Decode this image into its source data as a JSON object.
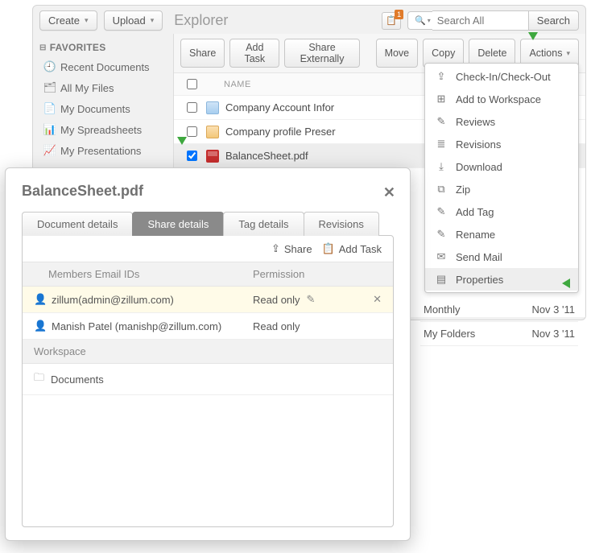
{
  "header": {
    "create_label": "Create",
    "upload_label": "Upload",
    "title": "Explorer",
    "notif_count": "1",
    "search_placeholder": "Search All",
    "search_button": "Search"
  },
  "sidebar": {
    "favorites_label": "FAVORITES",
    "items": [
      {
        "icon": "clock",
        "label": "Recent Documents"
      },
      {
        "icon": "files",
        "label": "All My Files"
      },
      {
        "icon": "doc",
        "label": "My Documents"
      },
      {
        "icon": "sheet",
        "label": "My Spreadsheets"
      },
      {
        "icon": "pres",
        "label": "My Presentations"
      }
    ]
  },
  "toolbar": {
    "share": "Share",
    "add_task": "Add Task",
    "share_ext": "Share Externally",
    "move": "Move",
    "copy": "Copy",
    "delete": "Delete",
    "actions": "Actions"
  },
  "table": {
    "header_name": "NAME",
    "rows": [
      {
        "checked": false,
        "type": "doc",
        "name": "Company Account Infor"
      },
      {
        "checked": false,
        "type": "ppt",
        "name": "Company profile Preser"
      },
      {
        "checked": true,
        "type": "pdf",
        "name": "BalanceSheet.pdf"
      }
    ]
  },
  "actions_menu": [
    {
      "icon": "⇪",
      "label": "Check-In/Check-Out"
    },
    {
      "icon": "⊞",
      "label": "Add to Workspace"
    },
    {
      "icon": "✎",
      "label": "Reviews"
    },
    {
      "icon": "≣",
      "label": "Revisions"
    },
    {
      "icon": "⤓",
      "label": "Download"
    },
    {
      "icon": "⧉",
      "label": "Zip"
    },
    {
      "icon": "✎",
      "label": "Add Tag"
    },
    {
      "icon": "✎",
      "label": "Rename"
    },
    {
      "icon": "✉",
      "label": "Send Mail"
    },
    {
      "icon": "▤",
      "label": "Properties",
      "highlight": true
    }
  ],
  "extra_rows": [
    {
      "label": "Monthly",
      "date": "Nov 3 '11"
    },
    {
      "label": "My Folders",
      "date": "Nov 3 '11"
    }
  ],
  "popup": {
    "title": "BalanceSheet.pdf",
    "tabs": {
      "doc_details": "Document details",
      "share_details": "Share details",
      "tag_details": "Tag details",
      "revisions": "Revisions"
    },
    "actions": {
      "share": "Share",
      "add_task": "Add Task"
    },
    "headers": {
      "members": "Members Email IDs",
      "permission": "Permission",
      "workspace": "Workspace"
    },
    "shares": [
      {
        "name": "zillum(admin@zillum.com)",
        "permission": "Read only",
        "editable": true,
        "highlight": true
      },
      {
        "name": "Manish Patel (manishp@zillum.com)",
        "permission": "Read only",
        "editable": false
      }
    ],
    "workspace_items": [
      {
        "name": "Documents"
      }
    ]
  }
}
